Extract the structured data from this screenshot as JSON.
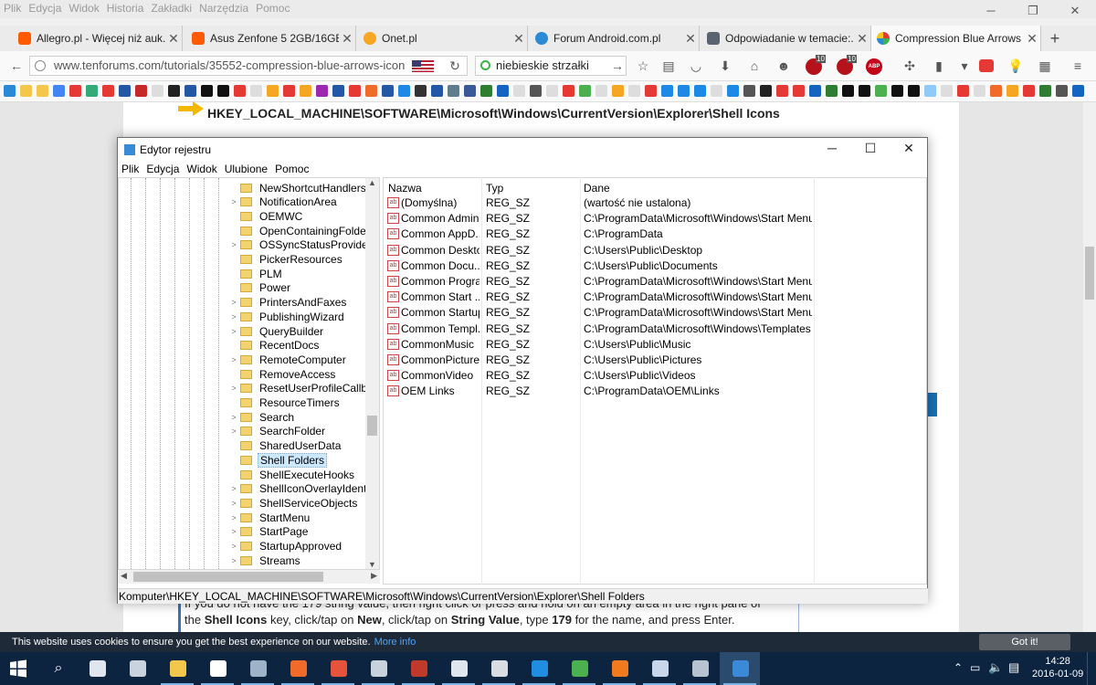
{
  "browser": {
    "menu": [
      "Plik",
      "Edycja",
      "Widok",
      "Historia",
      "Zakładki",
      "Narzędzia",
      "Pomoc"
    ],
    "tabs": [
      {
        "title": "Allegro.pl - Więcej niż auk...",
        "color": "#ff5a00"
      },
      {
        "title": "Asus Zenfone 5 2GB/16GB...",
        "color": "#ff5a00"
      },
      {
        "title": "Onet.pl",
        "color": "#f5a623"
      },
      {
        "title": "Forum Android.com.pl",
        "color": "#2b8ad6"
      },
      {
        "title": "Odpowiadanie w temacie:...",
        "color": "#5a6470"
      },
      {
        "title": "Compression Blue Arrows ...",
        "color": "#e23a3a"
      }
    ],
    "url": "www.tenforums.com/tutorials/35552-compression-blue-arrows-icon",
    "search_value": "niebieskie strzałki",
    "badges": [
      "10",
      "10",
      "ABP"
    ]
  },
  "webpage": {
    "heading": "HKEY_LOCAL_MACHINE\\SOFTWARE\\Microsoft\\Windows\\CurrentVersion\\Explorer\\Shell Icons",
    "para_line1": "If you do not have the 179 string value, then right click or press and hold on an empty area in the right pane of",
    "para_line2_parts": [
      "the ",
      "Shell Icons",
      " key, click/tap on ",
      "New",
      ", click/tap on ",
      "String Value",
      ", type ",
      "179",
      " for the name, and press Enter."
    ]
  },
  "regedit": {
    "title": "Edytor rejestru",
    "menu": [
      "Plik",
      "Edycja",
      "Widok",
      "Ulubione",
      "Pomoc"
    ],
    "tree": [
      {
        "label": "NewShortcutHandlers",
        "expandable": false
      },
      {
        "label": "NotificationArea",
        "expandable": true
      },
      {
        "label": "OEMWC",
        "expandable": false
      },
      {
        "label": "OpenContainingFolderHi",
        "expandable": false
      },
      {
        "label": "OSSyncStatusProviders",
        "expandable": true
      },
      {
        "label": "PickerResources",
        "expandable": false
      },
      {
        "label": "PLM",
        "expandable": false
      },
      {
        "label": "Power",
        "expandable": false
      },
      {
        "label": "PrintersAndFaxes",
        "expandable": true
      },
      {
        "label": "PublishingWizard",
        "expandable": true
      },
      {
        "label": "QueryBuilder",
        "expandable": true
      },
      {
        "label": "RecentDocs",
        "expandable": false
      },
      {
        "label": "RemoteComputer",
        "expandable": true
      },
      {
        "label": "RemoveAccess",
        "expandable": false
      },
      {
        "label": "ResetUserProfileCallback",
        "expandable": true
      },
      {
        "label": "ResourceTimers",
        "expandable": false
      },
      {
        "label": "Search",
        "expandable": true
      },
      {
        "label": "SearchFolder",
        "expandable": true
      },
      {
        "label": "SharedUserData",
        "expandable": false
      },
      {
        "label": "Shell Folders",
        "expandable": false,
        "selected": true
      },
      {
        "label": "ShellExecuteHooks",
        "expandable": false
      },
      {
        "label": "ShellIconOverlayIdentifie",
        "expandable": true
      },
      {
        "label": "ShellServiceObjects",
        "expandable": true
      },
      {
        "label": "StartMenu",
        "expandable": true
      },
      {
        "label": "StartPage",
        "expandable": true
      },
      {
        "label": "StartupApproved",
        "expandable": true
      },
      {
        "label": "Streams",
        "expandable": true
      }
    ],
    "columns": [
      "Nazwa",
      "Typ",
      "Dane"
    ],
    "rows": [
      {
        "name": "(Domyślna)",
        "type": "REG_SZ",
        "data": "(wartość nie ustalona)"
      },
      {
        "name": "Common Admin...",
        "type": "REG_SZ",
        "data": "C:\\ProgramData\\Microsoft\\Windows\\Start Menu\\P..."
      },
      {
        "name": "Common AppD...",
        "type": "REG_SZ",
        "data": "C:\\ProgramData"
      },
      {
        "name": "Common Desktop",
        "type": "REG_SZ",
        "data": "C:\\Users\\Public\\Desktop"
      },
      {
        "name": "Common Docu...",
        "type": "REG_SZ",
        "data": "C:\\Users\\Public\\Documents"
      },
      {
        "name": "Common Progra...",
        "type": "REG_SZ",
        "data": "C:\\ProgramData\\Microsoft\\Windows\\Start Menu\\P..."
      },
      {
        "name": "Common Start ...",
        "type": "REG_SZ",
        "data": "C:\\ProgramData\\Microsoft\\Windows\\Start Menu"
      },
      {
        "name": "Common Startup",
        "type": "REG_SZ",
        "data": "C:\\ProgramData\\Microsoft\\Windows\\Start Menu\\P..."
      },
      {
        "name": "Common Templ...",
        "type": "REG_SZ",
        "data": "C:\\ProgramData\\Microsoft\\Windows\\Templates"
      },
      {
        "name": "CommonMusic",
        "type": "REG_SZ",
        "data": "C:\\Users\\Public\\Music"
      },
      {
        "name": "CommonPictures",
        "type": "REG_SZ",
        "data": "C:\\Users\\Public\\Pictures"
      },
      {
        "name": "CommonVideo",
        "type": "REG_SZ",
        "data": "C:\\Users\\Public\\Videos"
      },
      {
        "name": "OEM Links",
        "type": "REG_SZ",
        "data": "C:\\ProgramData\\OEM\\Links"
      }
    ],
    "value_icon_text": "ab",
    "status": "Komputer\\HKEY_LOCAL_MACHINE\\SOFTWARE\\Microsoft\\Windows\\CurrentVersion\\Explorer\\Shell Folders"
  },
  "cookie": {
    "message": "This website uses cookies to ensure you get the best experience on our website.",
    "more": "More info",
    "button": "Got it!"
  },
  "taskbar": {
    "time": "14:28",
    "date": "2016-01-09",
    "apps": [
      {
        "name": "task-view",
        "color": "#dfe6ee"
      },
      {
        "name": "app-1",
        "color": "#c9d3dd"
      },
      {
        "name": "file-explorer",
        "color": "#f3c74b"
      },
      {
        "name": "store",
        "color": "#ffffff"
      },
      {
        "name": "steam",
        "color": "#9fb3c8"
      },
      {
        "name": "app-5",
        "color": "#f06a2a"
      },
      {
        "name": "app-6",
        "color": "#e6533c"
      },
      {
        "name": "app-7",
        "color": "#c8d2dc"
      },
      {
        "name": "app-8",
        "color": "#c0392b"
      },
      {
        "name": "app-9",
        "color": "#dfe6ee"
      },
      {
        "name": "app-10",
        "color": "#d9dde1"
      },
      {
        "name": "edge",
        "color": "#1f8ee0"
      },
      {
        "name": "chrome",
        "color": "#4caf50"
      },
      {
        "name": "firefox",
        "color": "#f17a1f"
      },
      {
        "name": "app-14",
        "color": "#c7d6ea"
      },
      {
        "name": "app-15",
        "color": "#b7c3d0"
      },
      {
        "name": "regedit",
        "color": "#3b8ad8"
      }
    ]
  }
}
